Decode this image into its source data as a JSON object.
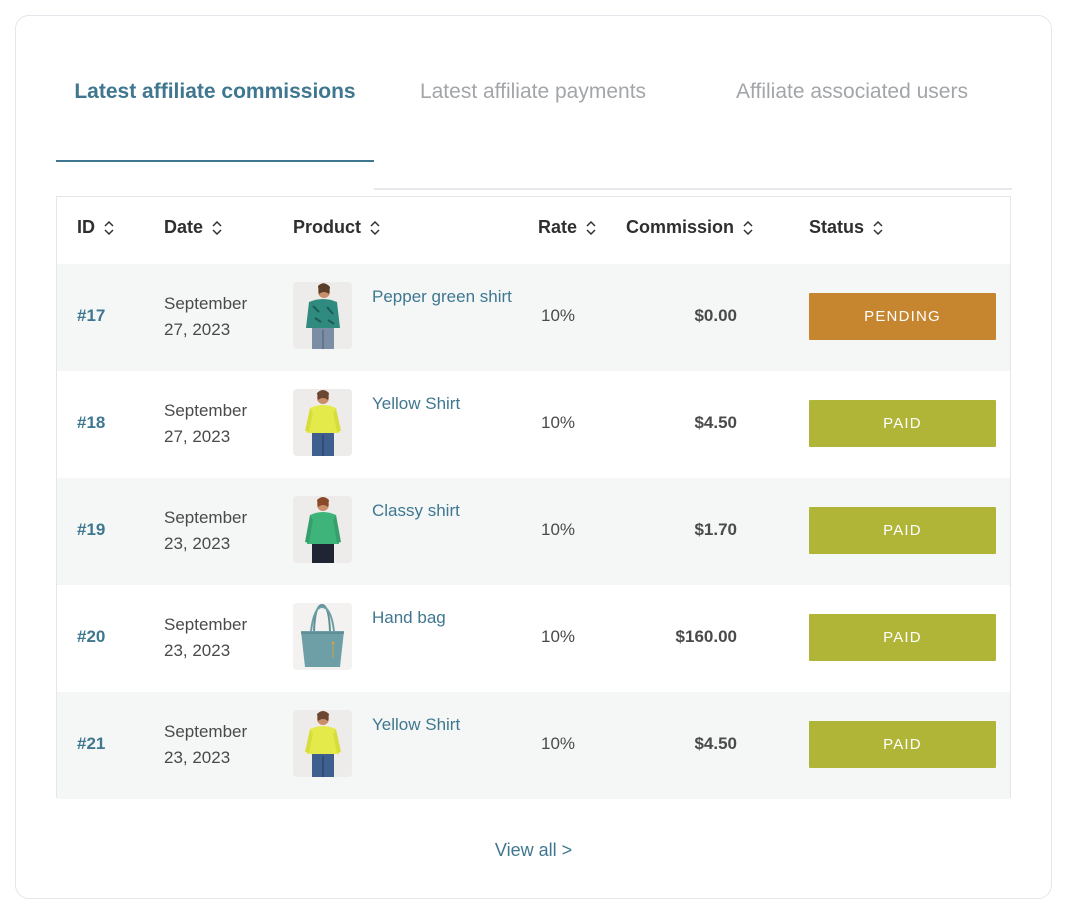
{
  "tabs": [
    {
      "label": "Latest affiliate commissions",
      "active": true
    },
    {
      "label": "Latest affiliate payments",
      "active": false
    },
    {
      "label": "Affiliate associated users",
      "active": false
    }
  ],
  "table": {
    "columns": [
      "ID",
      "Date",
      "Product",
      "Rate",
      "Commission",
      "Status"
    ],
    "rows": [
      {
        "id": "#17",
        "date": "September 27, 2023",
        "product": "Pepper green shirt",
        "thumb": "green-shirt",
        "rate": "10%",
        "commission": "$0.00",
        "status": "PENDING"
      },
      {
        "id": "#18",
        "date": "September 27, 2023",
        "product": "Yellow Shirt",
        "thumb": "yellow-shirt",
        "rate": "10%",
        "commission": "$4.50",
        "status": "PAID"
      },
      {
        "id": "#19",
        "date": "September 23, 2023",
        "product": "Classy shirt",
        "thumb": "classy-shirt",
        "rate": "10%",
        "commission": "$1.70",
        "status": "PAID"
      },
      {
        "id": "#20",
        "date": "September 23, 2023",
        "product": "Hand bag",
        "thumb": "hand-bag",
        "rate": "10%",
        "commission": "$160.00",
        "status": "PAID"
      },
      {
        "id": "#21",
        "date": "September 23, 2023",
        "product": "Yellow Shirt",
        "thumb": "yellow-shirt",
        "rate": "10%",
        "commission": "$4.50",
        "status": "PAID"
      }
    ]
  },
  "status_colors": {
    "PENDING": "#c5862f",
    "PAID": "#b0b437"
  },
  "footer": {
    "view_all": "View all >"
  }
}
